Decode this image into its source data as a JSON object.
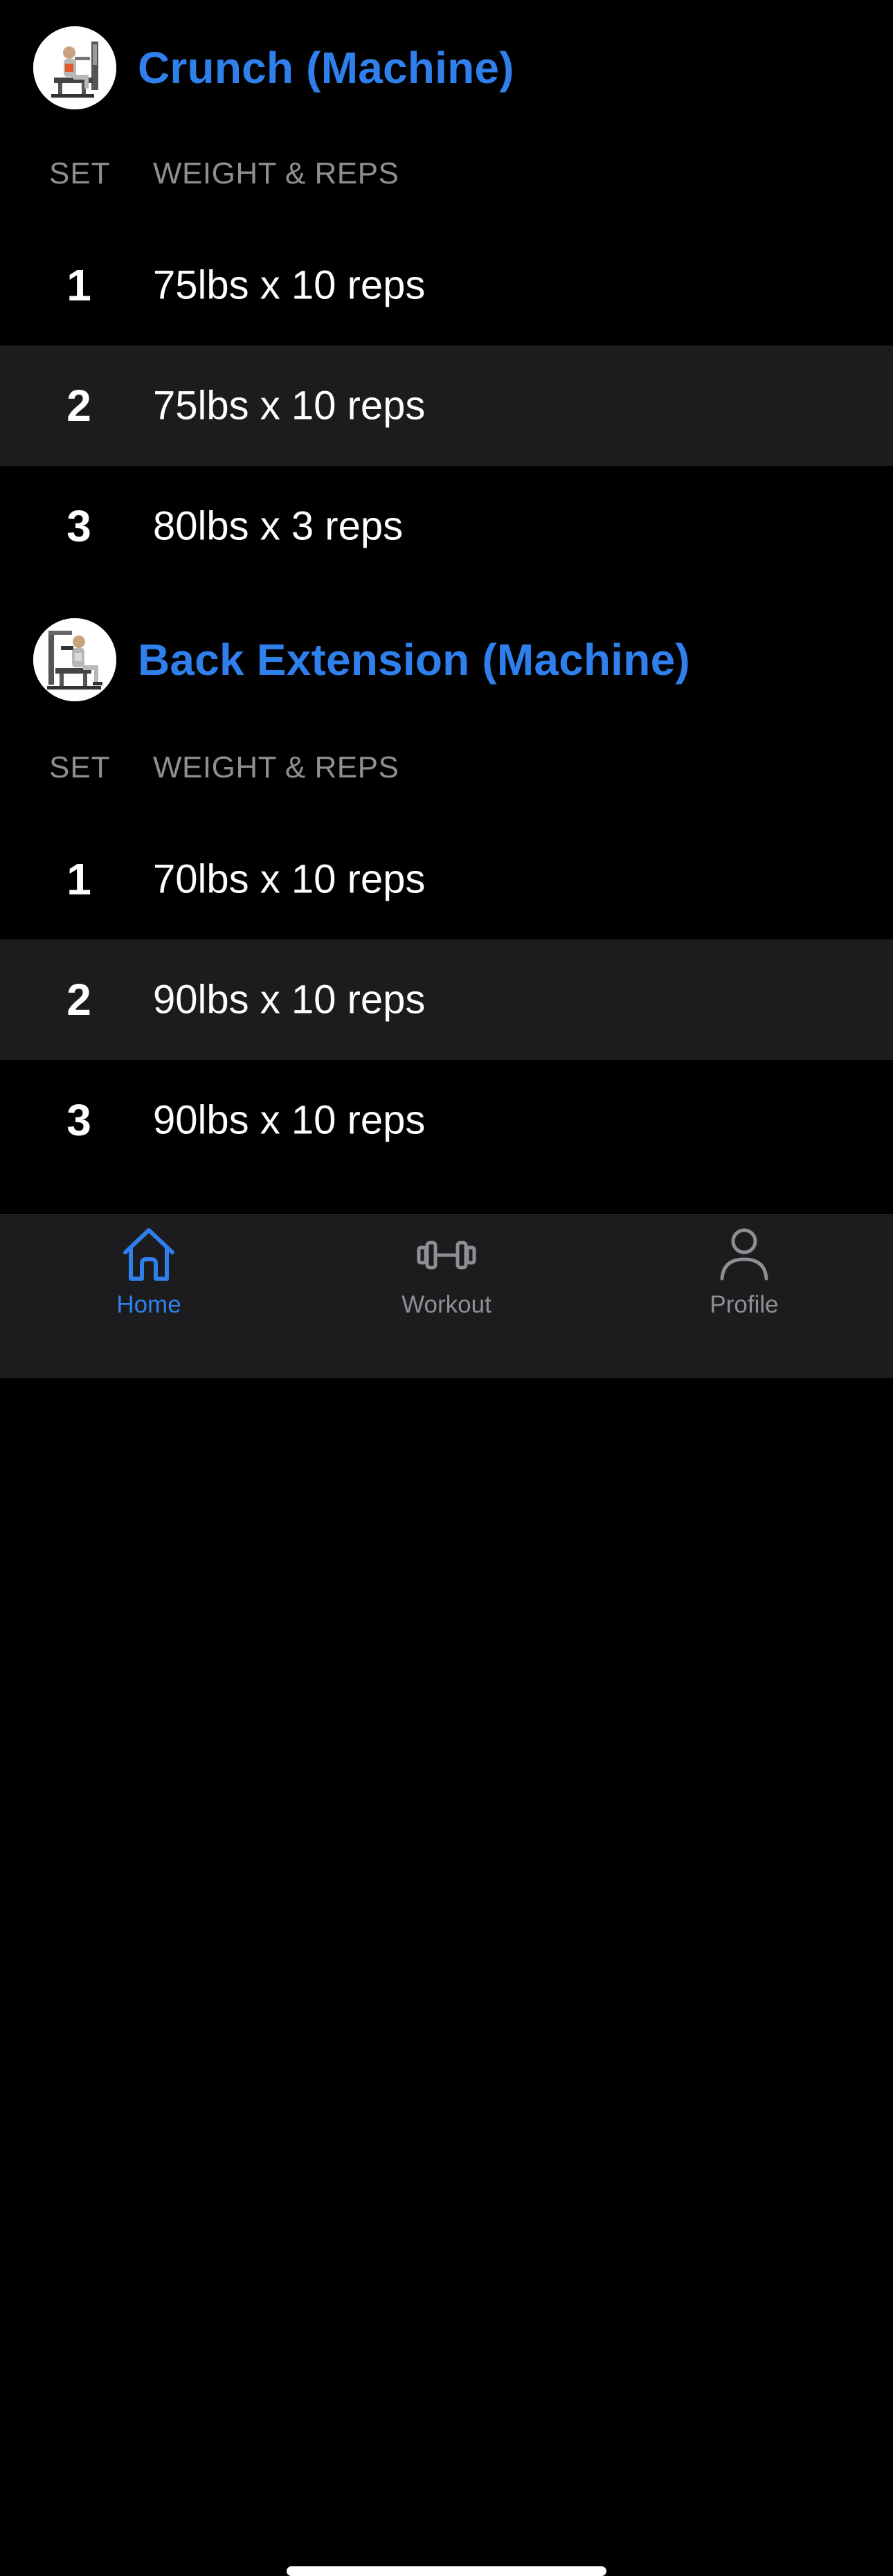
{
  "colors": {
    "accent": "#2f80ec",
    "background": "#000000",
    "row_alt": "#1c1c1e",
    "muted": "#8e8e93",
    "text": "#ffffff"
  },
  "exercises": [
    {
      "title": "Crunch (Machine)",
      "thumbnail_icon": "crunch-machine-illustration",
      "col_set": "SET",
      "col_weight_reps": "WEIGHT & REPS",
      "sets": [
        {
          "num": "1",
          "value": "75lbs x 10 reps"
        },
        {
          "num": "2",
          "value": "75lbs x 10 reps"
        },
        {
          "num": "3",
          "value": "80lbs x 3 reps"
        }
      ]
    },
    {
      "title": "Back Extension (Machine)",
      "thumbnail_icon": "back-extension-machine-illustration",
      "col_set": "SET",
      "col_weight_reps": "WEIGHT & REPS",
      "sets": [
        {
          "num": "1",
          "value": "70lbs x 10 reps"
        },
        {
          "num": "2",
          "value": "90lbs x 10 reps"
        },
        {
          "num": "3",
          "value": "90lbs x 10 reps"
        }
      ]
    }
  ],
  "tabbar": {
    "active": "home",
    "tabs": [
      {
        "id": "home",
        "label": "Home",
        "icon": "house-icon"
      },
      {
        "id": "workout",
        "label": "Workout",
        "icon": "dumbbell-icon"
      },
      {
        "id": "profile",
        "label": "Profile",
        "icon": "person-icon"
      }
    ]
  }
}
